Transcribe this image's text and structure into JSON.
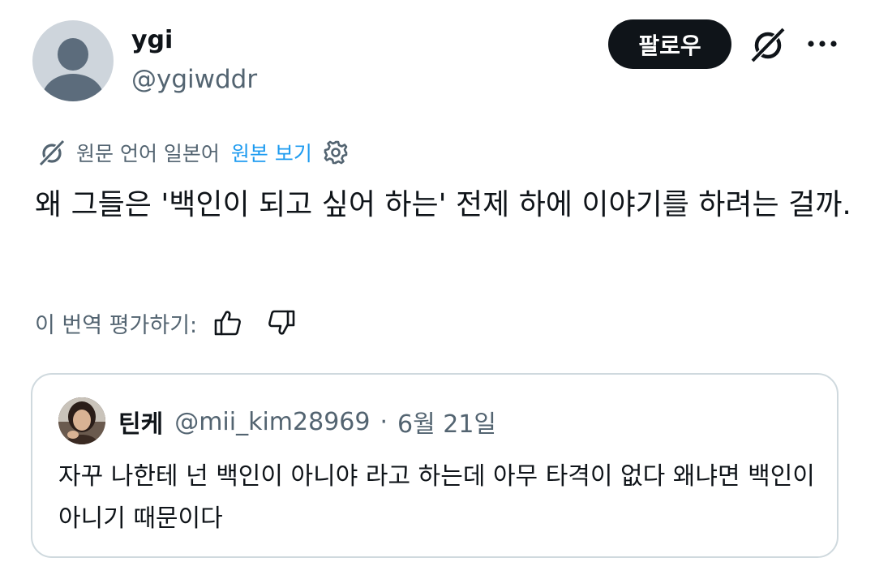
{
  "author": {
    "name": "ygi",
    "handle": "@ygiwddr"
  },
  "actions": {
    "follow_label": "팔로우"
  },
  "translation": {
    "source_language": "원문 언어 일본어",
    "show_original": "원본 보기"
  },
  "tweet": {
    "text": "왜 그들은 '백인이 되고 싶어 하는' 전제 하에 이야기를 하려는 걸까."
  },
  "rating": {
    "label": "이 번역 평가하기:"
  },
  "quote": {
    "name": "틴케",
    "handle": "@mii_kim28969",
    "separator": "·",
    "date": "6월 21일",
    "text": "자꾸 나한테 넌 백인이 아니야 라고 하는데 아무 타격이 없다 왜냐면 백인이 아니기 때문이다"
  },
  "icons": {
    "grok": "grok-icon",
    "more": "more-icon",
    "translate": "translate-icon",
    "settings": "gear-icon",
    "thumbs_up": "thumbs-up-icon",
    "thumbs_down": "thumbs-down-icon"
  },
  "colors": {
    "link": "#1d9bf0",
    "secondary_text": "#536471",
    "primary_text": "#0f1419",
    "border": "#cfd9de"
  }
}
